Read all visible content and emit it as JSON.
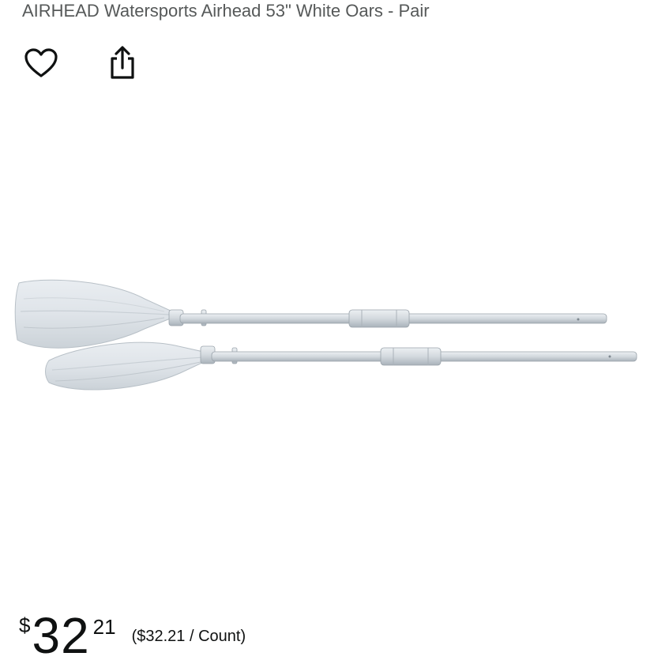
{
  "product": {
    "title": "AIRHEAD Watersports Airhead 53\" White Oars - Pair",
    "image_icon": "white-oars-pair-image"
  },
  "actions": {
    "wishlist_icon": "heart-icon",
    "share_icon": "share-icon"
  },
  "price": {
    "symbol": "$",
    "whole": "32",
    "fraction": "21",
    "unit_price": "($32.21 / Count)"
  }
}
